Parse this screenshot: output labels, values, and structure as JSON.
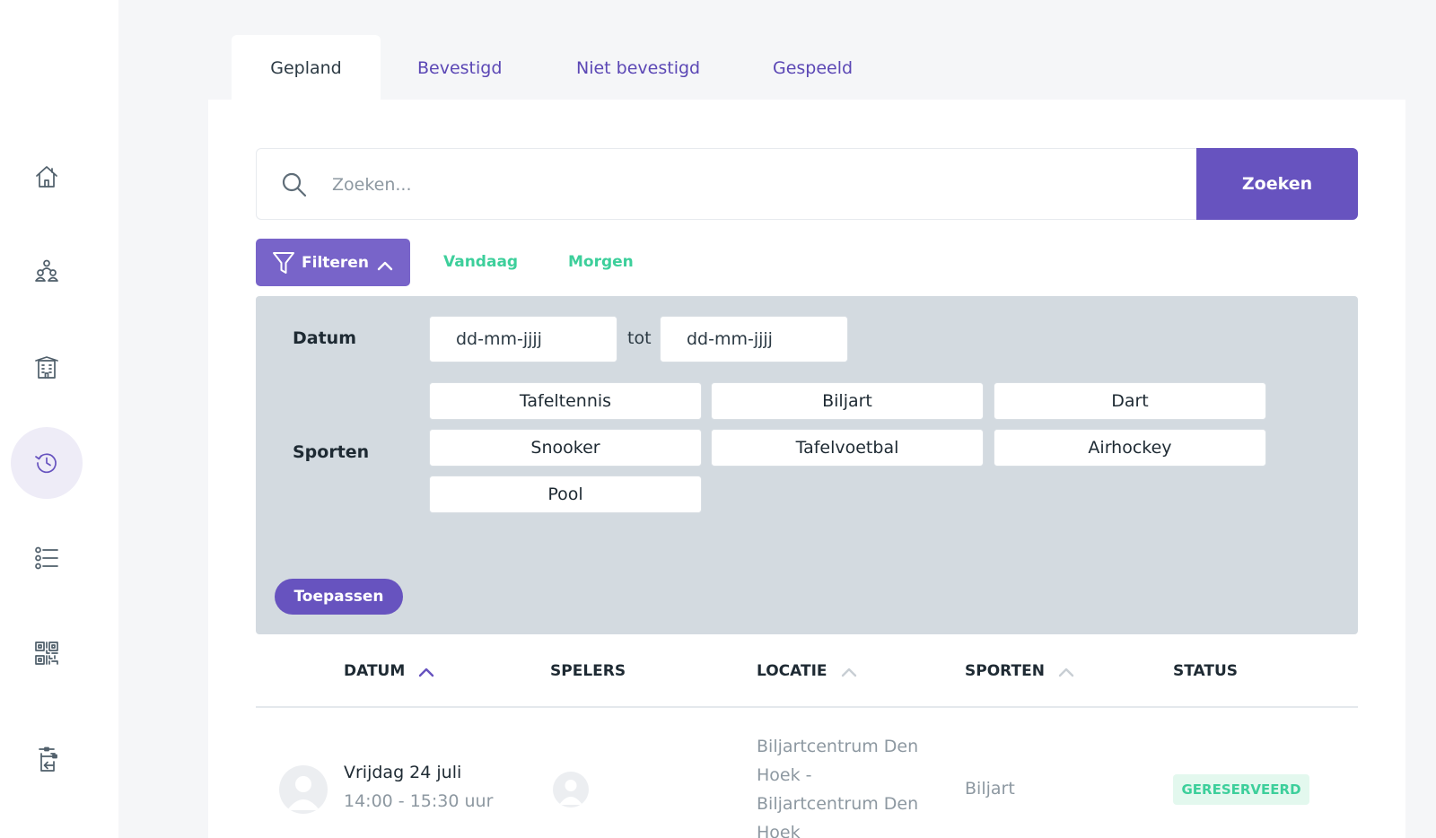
{
  "tabs": [
    {
      "label": "Gepland",
      "active": true
    },
    {
      "label": "Bevestigd",
      "active": false
    },
    {
      "label": "Niet bevestigd",
      "active": false
    },
    {
      "label": "Gespeeld",
      "active": false
    }
  ],
  "sidebar": {
    "items": [
      {
        "icon": "home-icon"
      },
      {
        "icon": "users-icon"
      },
      {
        "icon": "building-icon"
      },
      {
        "icon": "history-icon",
        "active": true
      },
      {
        "icon": "list-icon"
      },
      {
        "icon": "qr-code-icon"
      },
      {
        "icon": "logout-icon"
      }
    ]
  },
  "search": {
    "placeholder": "Zoeken...",
    "button_label": "Zoeken"
  },
  "filters": {
    "button_label": "Filteren",
    "quick": [
      "Vandaag",
      "Morgen"
    ],
    "date_label": "Datum",
    "date_from": "dd-mm-jjjj",
    "date_sep": "tot",
    "date_to": "dd-mm-jjjj",
    "sports_label": "Sporten",
    "sports": [
      "Tafeltennis",
      "Biljart",
      "Dart",
      "Snooker",
      "Tafelvoetbal",
      "Airhockey",
      "Pool"
    ],
    "apply_label": "Toepassen"
  },
  "table": {
    "columns": [
      "DATUM",
      "SPELERS",
      "LOCATIE",
      "SPORTEN",
      "STATUS"
    ],
    "rows": [
      {
        "date": "Vrijdag 24 juli",
        "time": "14:00 - 15:30 uur",
        "location": "Biljartcentrum Den Hoek - Biljartcentrum Den Hoek",
        "sport": "Biljart",
        "status": "GERESERVEERD"
      }
    ]
  },
  "colors": {
    "primary": "#6753bf",
    "accent_green": "#3dcf9b",
    "panel": "#d3dae0"
  }
}
